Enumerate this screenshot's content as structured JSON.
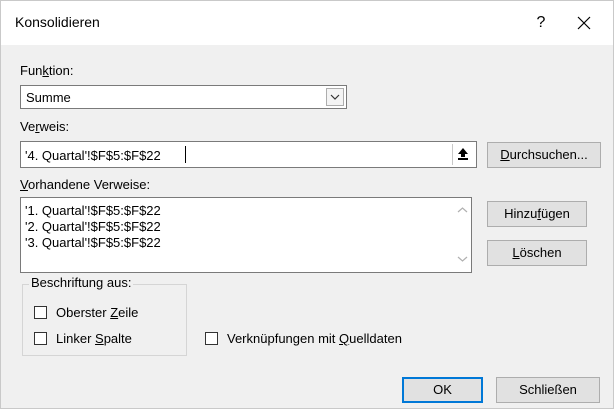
{
  "dialog": {
    "title": "Konsolidieren",
    "help_label": "?"
  },
  "function": {
    "label_pre": "Fun",
    "label_mnemonic": "k",
    "label_post": "tion:",
    "selected": "Summe"
  },
  "reference": {
    "label_pre": "Ve",
    "label_mnemonic": "r",
    "label_post": "weis:",
    "value": "'4. Quartal'!$F$5:$F$22",
    "browse_pre": "",
    "browse_mnemonic": "D",
    "browse_post": "urchsuchen..."
  },
  "existing": {
    "label_pre": "",
    "label_mnemonic": "V",
    "label_post": "orhandene Verweise:",
    "items": [
      "'1. Quartal'!$F$5:$F$22",
      "'2. Quartal'!$F$5:$F$22",
      "'3. Quartal'!$F$5:$F$22"
    ],
    "add_pre": "Hinzu",
    "add_mnemonic": "f",
    "add_post": "ügen",
    "delete_pre": "",
    "delete_mnemonic": "L",
    "delete_post": "öschen"
  },
  "labels_group": {
    "title": "Beschriftung aus:",
    "top_row_pre": "Oberster ",
    "top_row_mnemonic": "Z",
    "top_row_post": "eile",
    "left_col_pre": "Linker ",
    "left_col_mnemonic": "S",
    "left_col_post": "palte",
    "top_row_checked": false,
    "left_col_checked": false
  },
  "links": {
    "label_pre": "Verknüpfungen mit ",
    "label_mnemonic": "Q",
    "label_post": "uelldaten",
    "checked": false
  },
  "footer": {
    "ok_label": "OK",
    "close_label": "Schließen"
  },
  "colors": {
    "accent": "#0078d7",
    "dialog_bg": "#f0f0f0",
    "button_bg": "#e1e1e1"
  }
}
